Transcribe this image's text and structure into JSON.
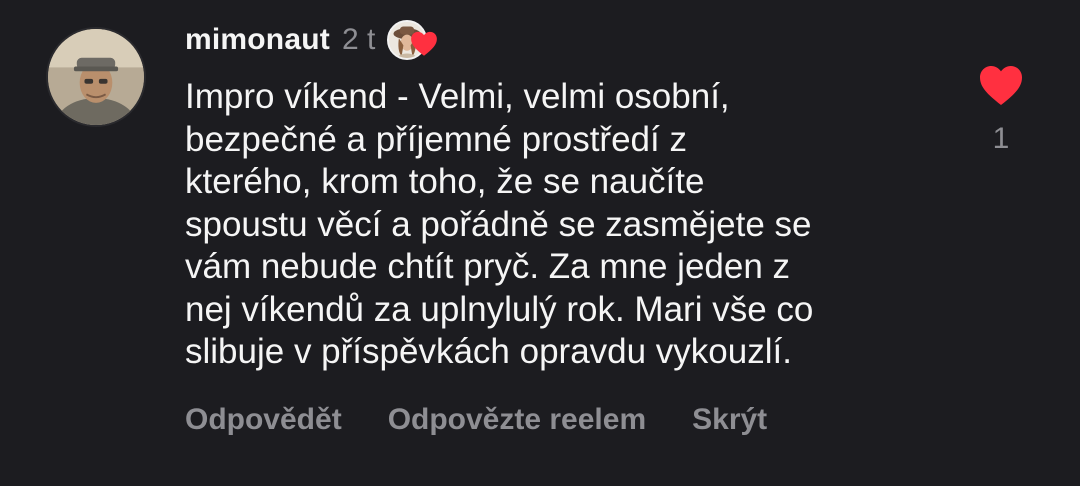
{
  "comment": {
    "username": "mimonaut",
    "time": "2 t",
    "text": "Impro víkend - Velmi, velmi osobní,\nbezpečné a příjemné prostředí z\nkterého, krom toho, že se naučíte\nspoustu věcí a pořádně se zasmějete se\nvám nebude chtít pryč. Za mne jeden z\nnej víkendů za uplnylulý rok. Mari vše co\nslibuje v příspěvkách opravdu vykouzlí.",
    "like_count": "1",
    "liked": true,
    "author_liked": true
  },
  "actions": {
    "reply": "Odpovědět",
    "reply_reel": "Odpovězte reelem",
    "hide": "Skrýt"
  },
  "colors": {
    "background": "#1c1c20",
    "text": "#f5f5f5",
    "muted": "#8e8e93",
    "heart": "#ff3040"
  },
  "icons": {
    "like": "heart-filled-icon",
    "author_like": "heart-filled-icon"
  }
}
